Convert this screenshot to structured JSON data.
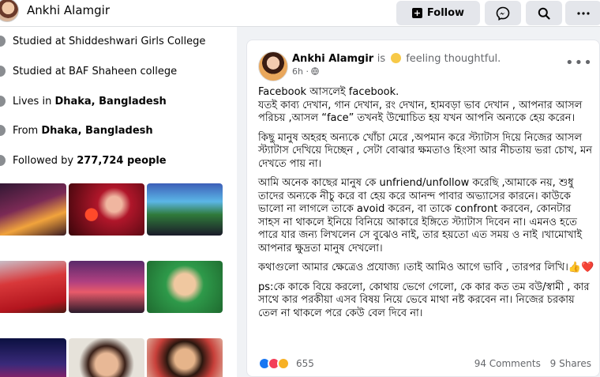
{
  "header": {
    "name": "Ankhi Alamgir",
    "follow_label": "Follow",
    "icons": [
      "messenger-icon",
      "search-icon",
      "more-icon"
    ]
  },
  "intro": [
    {
      "icon": "school-icon",
      "prefix": "Studied at Shiddeshwari Girls College",
      "bold": ""
    },
    {
      "icon": "school-icon",
      "prefix": "Studied at BAF Shaheen college",
      "bold": ""
    },
    {
      "icon": "home-icon",
      "prefix": "Lives in ",
      "bold": "Dhaka, Bangladesh"
    },
    {
      "icon": "location-icon",
      "prefix": "From ",
      "bold": "Dhaka, Bangladesh"
    },
    {
      "icon": "followers-icon",
      "prefix": "Followed by ",
      "bold": "277,724 people"
    }
  ],
  "post": {
    "author": "Ankhi Alamgir",
    "is": "is",
    "feeling": "feeling thoughtful.",
    "time": "6h ·",
    "body": [
      "Facebook আসলেই facebook.",
      "যতই কাব্য দেখান, গান দেখান, রং দেখান, হামবড়া ভাব দেখান , আপনার আসল পরিচয় ,আসল “face” তখনই উন্মোচিত হয় যখন আপনি অন্যকে হেয় করেন।",
      "কিছু মানুষ অহরহ অন্যকে খোঁচা মেরে ,অপমান করে স্ট্যাটাস দিয়ে নিজের আসল স্ট্যাটাস দেখিয়ে দিচ্ছেন , সেটা বোঝার ক্ষমতাও হিংসা আর নীচতায় ভরা চোখ, মন দেখতে পায় না।",
      "আমি অনেক কাছের মানুষ কে unfriend/unfollow করেছি ,আমাকে নয়, শুধু তাদের অন্যকে নীচু করে বা হেয় করে আনন্দ পাবার অভ্যাসের কারনে। কাউকে ভালো না লাগলে তাকে avoid করেন, বা তাকে confront করবেন, কোনটার সাহস না থাকলে ইনিয়ে বিনিয়ে আকারে ইঙ্গিতে স্ট্যাটাস দিবেন না। এমনও হতে পারে যার জন্য লিখলেন সে বুঝেও নাই, তার হয়তো এত সময় ও নাই ।খামোখাই আপনার ক্ষুদ্রতা মানুষ দেখলো।",
      " কথাগুলো আমার ক্ষেত্রেও প্রযোজ্য ।তাই আমিও আগে ভাবি , তারপর লিখি।👍❤️",
      "ps:কে কাকে বিয়ে করলো, কোথায় ভেগে গেলো, কে কার কত তম বউ/স্বামী , কার সাথে কার পরকীয়া এসব বিষয় নিয়ে ভেবে মাথা নষ্ট করবেন না। নিজের চরকায় তেল না থাকলে পরে কেউ বেল দিবে না।"
    ],
    "reaction_count": "655",
    "comments": "94 Comments",
    "shares": "9 Shares"
  },
  "colors": {
    "like": "#1877f2",
    "love": "#f33e58",
    "haha": "#f7b125"
  }
}
